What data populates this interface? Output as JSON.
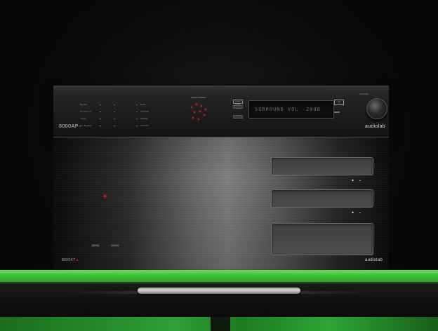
{
  "top_unit": {
    "model": "8000AP",
    "model_suffix": "™",
    "brand": "audiolab",
    "sources_left": [
      "Digital",
      "AV Ext-Ch",
      "Tuner",
      "7.1 Bypass"
    ],
    "sources_right": [
      "DVD",
      "SAT/Cbl",
      "VIDEO",
      "AUX/TV"
    ],
    "io_label": "AUDIO MODES",
    "display_text": "SURROUND VOL -20dB",
    "dsp_badge": "DOLBY DIGITAL",
    "hdmi_badge": "DTS",
    "hdmi_label": "HDMI",
    "volume_label": "VOLUME"
  },
  "bottom_unit": {
    "model": "8000X7",
    "brand": "audiolab",
    "eject_symbol": "▲"
  },
  "colors": {
    "shelf_green": "#41c43c",
    "led_red": "#e02020",
    "brushed_metal": "#808080"
  }
}
